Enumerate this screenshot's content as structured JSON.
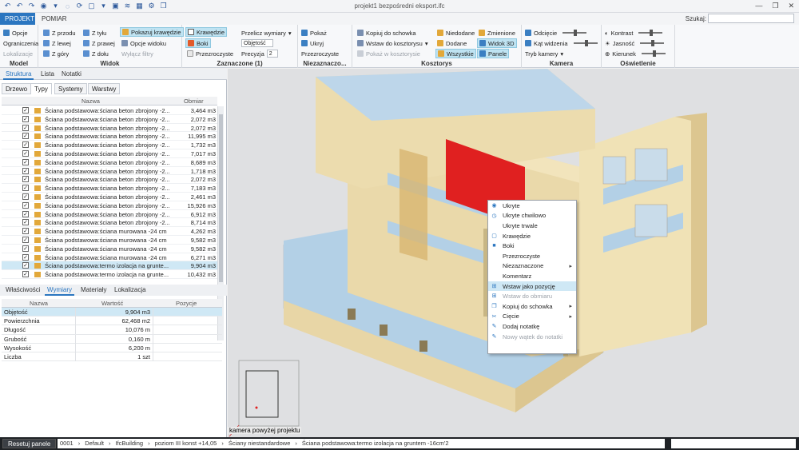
{
  "app": {
    "title": "projekt1 bezpośredni eksport.ifc",
    "tabs": [
      "PROJEKT",
      "POMIAR"
    ],
    "search_label": "Szukaj:"
  },
  "ribbon": {
    "model": {
      "title": "Model",
      "items": [
        "Opcje",
        "Ograniczenia",
        "Lokalizacje"
      ]
    },
    "widok": {
      "title": "Widok",
      "items": [
        "Z przodu",
        "Z lewej",
        "Z góry",
        "Z tyłu",
        "Z prawej",
        "Z dołu"
      ]
    },
    "zaznaczone": {
      "title": "Zaznaczone (1)",
      "pokazuj": "Pokazuj krawędzie",
      "opcje": "Opcje widoku",
      "wylacz": "Wyłącz filtry",
      "krawedzie": "Krawędzie",
      "boki": "Boki",
      "przezroczyste": "Przezroczyste",
      "przelicz": "Przelicz wymiary",
      "objetosc": "Objętość",
      "precyzja": "Precyzja",
      "precyzja_val": "2"
    },
    "niezaznaczone": {
      "title": "Niezaznaczo...",
      "items": [
        "Pokaż",
        "Ukryj",
        "Przezroczyste"
      ]
    },
    "kosztorys": {
      "title": "Kosztorys",
      "kopiuj": "Kopiuj do schowka",
      "wstaw": "Wstaw do kosztorysu",
      "pokaz": "Pokaż w kosztorysie",
      "nieodane": "Niedodane",
      "dodane": "Dodane",
      "wszystkie": "Wszystkie",
      "zmienione": "Zmienione",
      "widok3d": "Widok 3D",
      "panele": "Panele"
    },
    "kamera": {
      "title": "Kamera",
      "odciecie": "Odcięcie",
      "kat": "Kąt widzenia",
      "tryb": "Tryb kamery"
    },
    "oswietlenie": {
      "title": "Oświetlenie",
      "kontrast": "Kontrast",
      "jasnosc": "Jasność",
      "kierunek": "Kierunek"
    }
  },
  "left_panel": {
    "tabs": [
      "Struktura",
      "Lista",
      "Notatki"
    ],
    "subtabs": [
      "Drzewo",
      "Typy",
      "Systemy",
      "Warstwy"
    ],
    "columns": [
      "Nazwa",
      "Obmiar"
    ],
    "rows": [
      {
        "name": "Ściana podstawowa:ściana beton zbrojony -2...",
        "value": "3,464 m3"
      },
      {
        "name": "Ściana podstawowa:ściana beton zbrojony -2...",
        "value": "2,072 m3"
      },
      {
        "name": "Ściana podstawowa:ściana beton zbrojony -2...",
        "value": "2,072 m3"
      },
      {
        "name": "Ściana podstawowa:ściana beton zbrojony -2...",
        "value": "11,995 m3"
      },
      {
        "name": "Ściana podstawowa:ściana beton zbrojony -2...",
        "value": "1,732 m3"
      },
      {
        "name": "Ściana podstawowa:ściana beton zbrojony -2...",
        "value": "7,017 m3"
      },
      {
        "name": "Ściana podstawowa:ściana beton zbrojony -2...",
        "value": "8,689 m3"
      },
      {
        "name": "Ściana podstawowa:ściana beton zbrojony -2...",
        "value": "1,718 m3"
      },
      {
        "name": "Ściana podstawowa:ściana beton zbrojony -2...",
        "value": "2,072 m3"
      },
      {
        "name": "Ściana podstawowa:ściana beton zbrojony -2...",
        "value": "7,183 m3"
      },
      {
        "name": "Ściana podstawowa:ściana beton zbrojony -2...",
        "value": "2,461 m3"
      },
      {
        "name": "Ściana podstawowa:ściana beton zbrojony -2...",
        "value": "15,926 m3"
      },
      {
        "name": "Ściana podstawowa:ściana beton zbrojony -2...",
        "value": "6,912 m3"
      },
      {
        "name": "Ściana podstawowa:ściana beton zbrojony -2...",
        "value": "8,714 m3"
      },
      {
        "name": "Ściana podstawowa:ściana murowana -24 cm",
        "value": "4,262 m3"
      },
      {
        "name": "Ściana podstawowa:ściana murowana -24 cm",
        "value": "9,582 m3"
      },
      {
        "name": "Ściana podstawowa:ściana murowana -24 cm",
        "value": "9,582 m3"
      },
      {
        "name": "Ściana podstawowa:ściana murowana -24 cm",
        "value": "6,271 m3"
      },
      {
        "name": "Ściana podstawowa:termo izolacja na grunte...",
        "value": "9,904 m3"
      },
      {
        "name": "Ściana podstawowa:termo izolacja na grunte...",
        "value": "10,432 m3"
      }
    ],
    "bottom_tabs": [
      "Właściwości",
      "Wymiary",
      "Materiały",
      "Lokalizacja"
    ],
    "prop_columns": [
      "Nazwa",
      "Wartość",
      "Pozycje"
    ],
    "props": [
      {
        "name": "Objętość",
        "value": "9,904 m3"
      },
      {
        "name": "Powierzchnia",
        "value": "62,468 m2"
      },
      {
        "name": "Długość",
        "value": "10,076 m"
      },
      {
        "name": "Grubość",
        "value": "0,160 m"
      },
      {
        "name": "Wysokość",
        "value": "6,200 m"
      },
      {
        "name": "Liczba",
        "value": "1 szt"
      }
    ]
  },
  "viewport": {
    "camera_label": "kamera powyżej projektu"
  },
  "context_menu": {
    "items": [
      {
        "label": "Ukryte",
        "icon": "eye-icon"
      },
      {
        "label": "Ukryte chwilowo",
        "icon": "clock-icon"
      },
      {
        "label": "Ukryte trwale",
        "icon": ""
      },
      {
        "label": "Krawędzie",
        "icon": "square-icon"
      },
      {
        "label": "Boki",
        "icon": "fill-icon"
      },
      {
        "label": "Przezroczyste",
        "icon": ""
      },
      {
        "label": "Niezaznaczone",
        "icon": "",
        "sub": true
      },
      {
        "label": "Komentarz",
        "icon": ""
      },
      {
        "label": "Wstaw jako pozycję",
        "icon": "insert-icon"
      },
      {
        "label": "Wstaw do obmiaru",
        "icon": "insert-icon"
      },
      {
        "label": "Kopiuj do schowka",
        "icon": "copy-icon",
        "sub": true
      },
      {
        "label": "Cięcie",
        "icon": "cut-icon",
        "sub": true
      },
      {
        "label": "Dodaj notatkę",
        "icon": "note-icon"
      },
      {
        "label": "Nowy wątek do notatki",
        "icon": "note-icon"
      }
    ]
  },
  "statusbar": {
    "reset": "Resetuj panele",
    "crumbs": [
      "0001",
      "Default",
      "IfcBuilding",
      "poziom III konst +14,05",
      "Ściany niestandardowe",
      "Ściana podstawowa:termo izolacja na gruntem -16cm'2"
    ]
  }
}
